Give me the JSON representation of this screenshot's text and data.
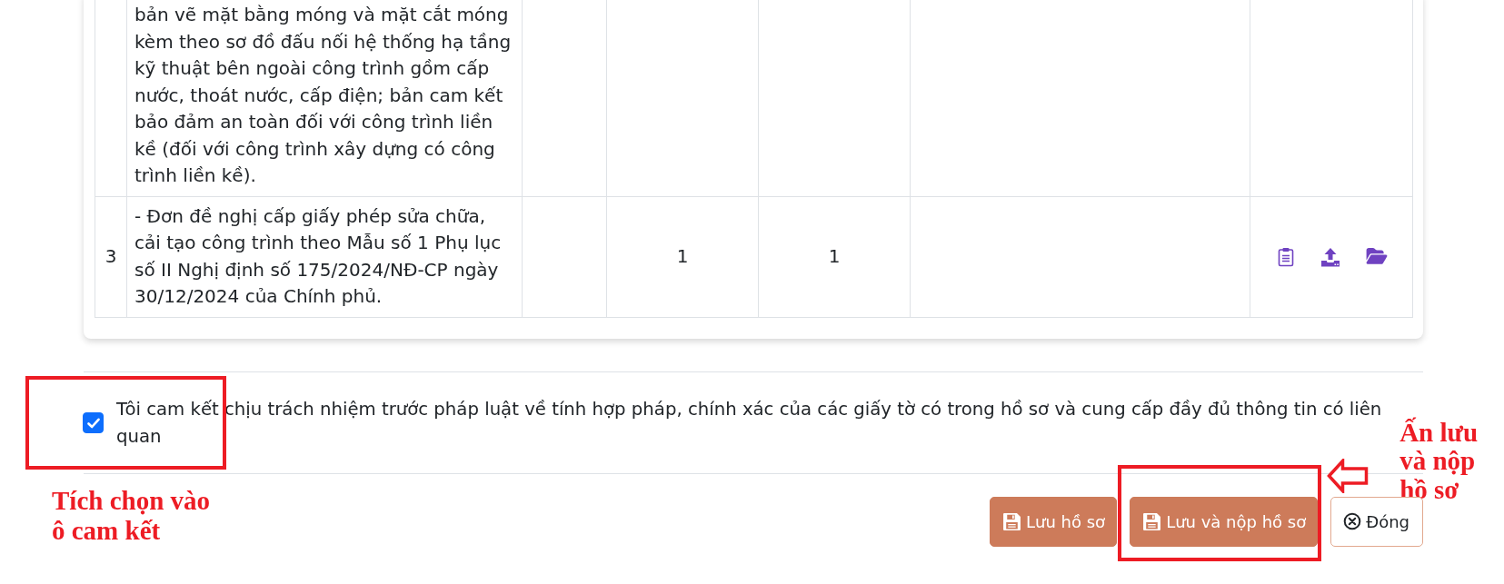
{
  "document_table": {
    "rows": [
      {
        "text": "bản vẽ mặt bằng móng và mặt cắt móng kèm theo sơ đồ đấu nối hệ thống hạ tầng kỹ thuật bên ngoài công trình gồm cấp nước, thoát nước, cấp điện; bản cam kết bảo đảm an toàn đối với công trình liền kề (đối với công trình xây dựng có công trình liền kề).",
        "has_file_actions": false
      },
      {
        "number": "3",
        "text": "- Đơn đề nghị cấp giấy phép sửa chữa, cải tạo công trình theo Mẫu số 1 Phụ lục số II Nghị định số 175/2024/NĐ-CP ngày 30/12/2024 của Chính phủ.",
        "column_4": "1",
        "column_5": "1",
        "has_file_actions": true
      }
    ]
  },
  "commitment": {
    "checked": true,
    "text": "Tôi cam kết chịu trách nhiệm trước pháp luật về tính hợp pháp, chính xác của các giấy tờ có trong hồ sơ và cung cấp đầy đủ thông tin có liên quan",
    "highlighted": true,
    "note": "Tích chọn vào ô cam kết"
  },
  "buttons": [
    {
      "kind": "save",
      "label": "Lưu hồ sơ",
      "highlighted": false
    },
    {
      "kind": "save",
      "label": "Lưu và nộp hồ sơ",
      "highlighted": true,
      "note": "Ấn lưu và nộp hồ sơ"
    },
    {
      "kind": "close",
      "label": "Đóng",
      "highlighted": false
    }
  ]
}
